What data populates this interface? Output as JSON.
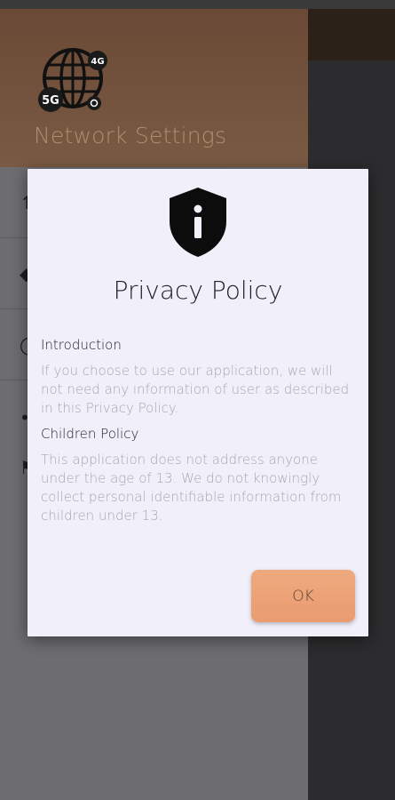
{
  "drawer": {
    "title": "Network Settings",
    "logo_badges": [
      "5G",
      "4G"
    ]
  },
  "dialog": {
    "title": "Privacy Policy",
    "sections": [
      {
        "heading": "Introduction",
        "body": "If you choose to use our application, we will not need any information of user as described in this Privacy Policy."
      },
      {
        "heading": "Children Policy",
        "body": "This application does not address anyone under the age of 13. We do not knowingly collect personal identifiable information from children under 13."
      }
    ],
    "ok_label": "OK"
  },
  "colors": {
    "dialog_bg": "#f0effa",
    "button": "#eba275",
    "drawer_header": "#72523c"
  }
}
